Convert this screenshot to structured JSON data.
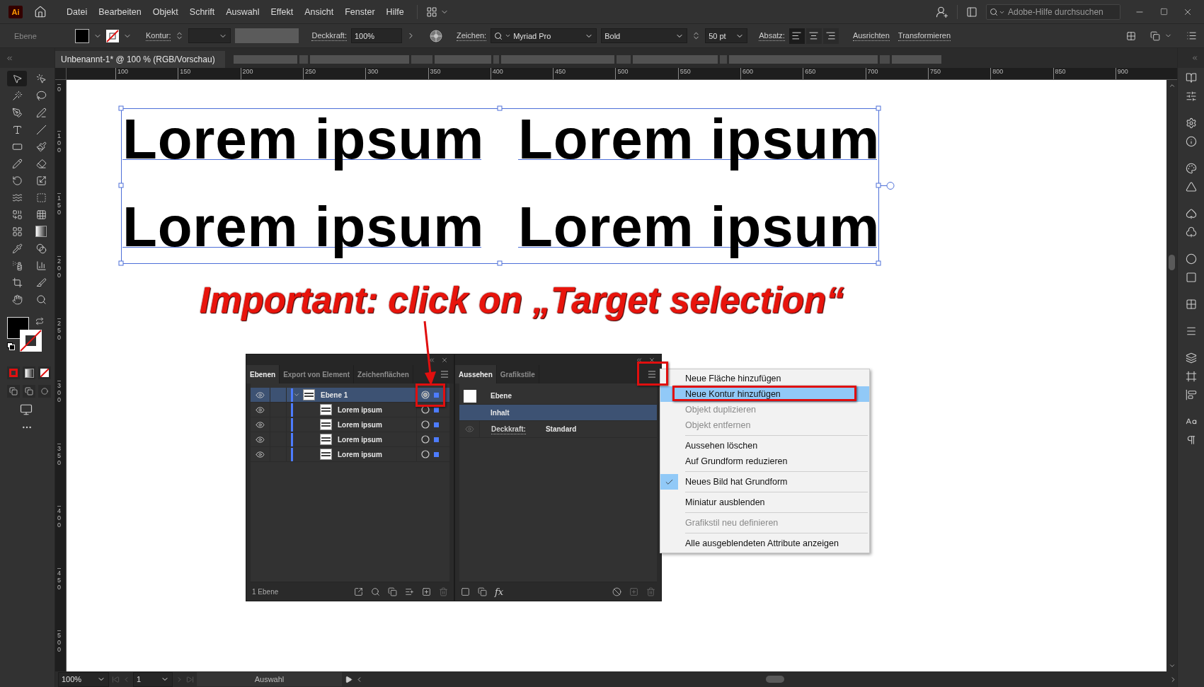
{
  "app": {
    "logo": "Ai",
    "menu": [
      "Datei",
      "Bearbeiten",
      "Objekt",
      "Schrift",
      "Auswahl",
      "Effekt",
      "Ansicht",
      "Fenster",
      "Hilfe"
    ],
    "search": {
      "placeholder": "Adobe-Hilfe durchsuchen"
    }
  },
  "control_bar": {
    "selection_label": "Ebene",
    "stroke_label": "Kontur:",
    "opacity_label": "Deckkraft:",
    "opacity": "100%",
    "character_label": "Zeichen:",
    "font": "Myriad Pro",
    "style": "Bold",
    "size": "50 pt",
    "paragraph_label": "Absatz:",
    "align": [
      {
        "kind": "left",
        "selected": true
      },
      {
        "kind": "center",
        "selected": false
      },
      {
        "kind": "right",
        "selected": false
      }
    ],
    "links": [
      "Ausrichten",
      "Transformieren"
    ]
  },
  "document_tab": {
    "title": "Unbenannt-1* @ 100 % (RGB/Vorschau)"
  },
  "tools": [
    {
      "kind": "pointer",
      "selected": true
    },
    {
      "kind": "direct",
      "selected": false
    },
    {
      "kind": "wand",
      "selected": false
    },
    {
      "kind": "lasso",
      "selected": false
    },
    {
      "kind": "pen",
      "selected": false
    },
    {
      "kind": "curvature",
      "selected": false
    },
    {
      "kind": "type",
      "selected": false
    },
    {
      "kind": "line",
      "selected": false
    },
    {
      "kind": "rectangle",
      "selected": false
    },
    {
      "kind": "brush",
      "selected": false
    },
    {
      "kind": "shaper",
      "selected": false
    },
    {
      "kind": "eraser",
      "selected": false
    },
    {
      "kind": "rotate",
      "selected": false
    },
    {
      "kind": "scale",
      "selected": false
    },
    {
      "kind": "warp",
      "selected": false
    },
    {
      "kind": "free-transform",
      "selected": false
    },
    {
      "kind": "shape-builder",
      "selected": false
    },
    {
      "kind": "perspective",
      "selected": false
    },
    {
      "kind": "mesh",
      "selected": false
    },
    {
      "kind": "gradient",
      "selected": false
    },
    {
      "kind": "eyedropper",
      "selected": false
    },
    {
      "kind": "blend",
      "selected": false
    },
    {
      "kind": "symbol",
      "selected": false
    },
    {
      "kind": "graph",
      "selected": false
    },
    {
      "kind": "artboard",
      "selected": false
    },
    {
      "kind": "slice",
      "selected": false
    },
    {
      "kind": "hand",
      "selected": false
    },
    {
      "kind": "zoom",
      "selected": false
    }
  ],
  "rulers": {
    "horizontal": [
      "100",
      "150",
      "200",
      "250",
      "300",
      "350",
      "400",
      "450",
      "500",
      "550",
      "600",
      "650",
      "700",
      "750",
      "800",
      "850",
      "900"
    ],
    "vertical": [
      "0",
      "100",
      "150",
      "200",
      "250",
      "300",
      "350",
      "400",
      "450",
      "500"
    ]
  },
  "canvas": {
    "texts": [
      "Lorem ipsum",
      "Lorem ipsum",
      "Lorem ipsum",
      "Lorem ipsum"
    ],
    "annotation": "Important: click on „Target selection“"
  },
  "layers_panel": {
    "tabs": [
      {
        "label": "Ebenen",
        "selected": true
      },
      {
        "label": "Export von Element",
        "selected": false
      },
      {
        "label": "Zeichenflächen",
        "selected": false
      }
    ],
    "layers": [
      {
        "name": "Ebene 1",
        "selected": true,
        "expanded": true,
        "targeted": true,
        "children": [
          {
            "name": "Lorem ipsum",
            "selected": false,
            "targeted": false
          },
          {
            "name": "Lorem ipsum",
            "selected": false,
            "targeted": false
          },
          {
            "name": "Lorem ipsum",
            "selected": false,
            "targeted": false
          },
          {
            "name": "Lorem ipsum",
            "selected": false,
            "targeted": false
          }
        ]
      }
    ],
    "footer": "1 Ebene"
  },
  "appearance_panel": {
    "tabs": [
      {
        "label": "Aussehen",
        "selected": true
      },
      {
        "label": "Grafikstile",
        "selected": false
      }
    ],
    "rows": [
      {
        "kind": "header",
        "label": "Ebene",
        "selected": false
      },
      {
        "kind": "content",
        "label": "Inhalt",
        "selected": true
      },
      {
        "kind": "attribute",
        "label": "Deckkraft:",
        "value": "Standard",
        "selected": false
      }
    ],
    "effects_button": "fx"
  },
  "context_menu": {
    "groups": [
      {
        "items": [
          {
            "label": "Neue Fläche hinzufügen",
            "selected": false,
            "disabled": false,
            "checked": false
          },
          {
            "label": "Neue Kontur hinzufügen",
            "selected": true,
            "disabled": false,
            "checked": false
          },
          {
            "label": "Objekt duplizieren",
            "selected": false,
            "disabled": true,
            "checked": false
          },
          {
            "label": "Objekt entfernen",
            "selected": false,
            "disabled": true,
            "checked": false
          }
        ]
      },
      {
        "items": [
          {
            "label": "Aussehen löschen",
            "selected": false,
            "disabled": false,
            "checked": false
          },
          {
            "label": "Auf Grundform reduzieren",
            "selected": false,
            "disabled": false,
            "checked": false
          }
        ]
      },
      {
        "items": [
          {
            "label": "Neues Bild hat Grundform",
            "selected": false,
            "disabled": false,
            "checked": true
          }
        ]
      },
      {
        "items": [
          {
            "label": "Miniatur ausblenden",
            "selected": false,
            "disabled": false,
            "checked": false
          }
        ]
      },
      {
        "items": [
          {
            "label": "Grafikstil neu definieren",
            "selected": false,
            "disabled": true,
            "checked": false
          }
        ]
      },
      {
        "items": [
          {
            "label": "Alle ausgeblendeten Attribute anzeigen",
            "selected": false,
            "disabled": false,
            "checked": false
          }
        ]
      }
    ]
  },
  "status_bar": {
    "zoom": "100%",
    "artboard": "1",
    "tool": "Auswahl"
  }
}
